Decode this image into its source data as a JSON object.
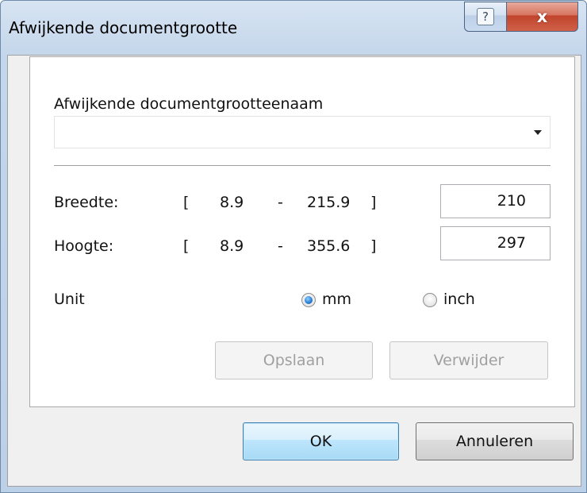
{
  "window": {
    "title": "Afwijkende documentgrootte",
    "help_glyph": "?",
    "close_glyph": "x"
  },
  "form": {
    "name_label": "Afwijkende documentgrootteenaam",
    "name_value": "",
    "width": {
      "label": "Breedte:",
      "open_bracket": "[",
      "min": "8.9",
      "dash": "-",
      "max": "215.9",
      "close_bracket": "]",
      "value": "210"
    },
    "height": {
      "label": "Hoogte:",
      "open_bracket": "[",
      "min": "8.9",
      "dash": "-",
      "max": "355.6",
      "close_bracket": "]",
      "value": "297"
    },
    "unit": {
      "label": "Unit",
      "options": [
        "mm",
        "inch"
      ],
      "selected": "mm"
    },
    "save_label": "Opslaan",
    "delete_label": "Verwijder"
  },
  "footer": {
    "ok_label": "OK",
    "cancel_label": "Annuleren"
  }
}
